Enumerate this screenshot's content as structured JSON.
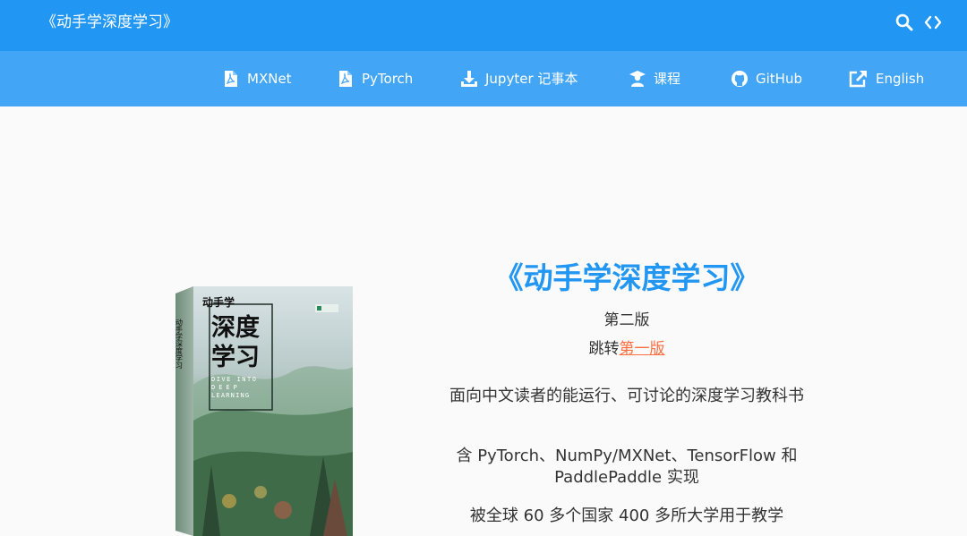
{
  "header": {
    "title": "《动手学深度学习》",
    "icons": [
      "search-icon",
      "code-icon"
    ]
  },
  "nav": {
    "items": [
      {
        "label": "MXNet",
        "icon": "pdf-icon"
      },
      {
        "label": "PyTorch",
        "icon": "pdf-icon"
      },
      {
        "label": "Jupyter 记事本",
        "icon": "download-icon"
      },
      {
        "label": "课程",
        "icon": "graduation-cap-icon"
      },
      {
        "label": "GitHub",
        "icon": "github-icon"
      },
      {
        "label": "English",
        "icon": "external-link-icon"
      }
    ]
  },
  "hero": {
    "title": "《动手学深度学习》",
    "edition": "第二版",
    "jump_prefix": "跳转",
    "jump_link": "第一版",
    "features": [
      "面向中文读者的能运行、可讨论的深度学习教科书",
      "含 PyTorch、NumPy/MXNet、TensorFlow 和 PaddlePaddle 实现",
      "被全球 60 多个国家 400 多所大学用于教学"
    ]
  },
  "cover": {
    "title": "动手学深度学习",
    "title_top": "动手学",
    "title_main_1": "深度",
    "title_main_2": "学习",
    "spine": "动手学深度学习",
    "english_1": "DIVE INTO",
    "english_2": "DEEP",
    "english_3": "LEARNING"
  },
  "colors": {
    "header_bg": "#2196f3",
    "nav_bg": "#42a5f5",
    "accent": "#2196f3",
    "link": "#ff6e40",
    "text": "#333333",
    "page_bg": "#fafafa"
  }
}
